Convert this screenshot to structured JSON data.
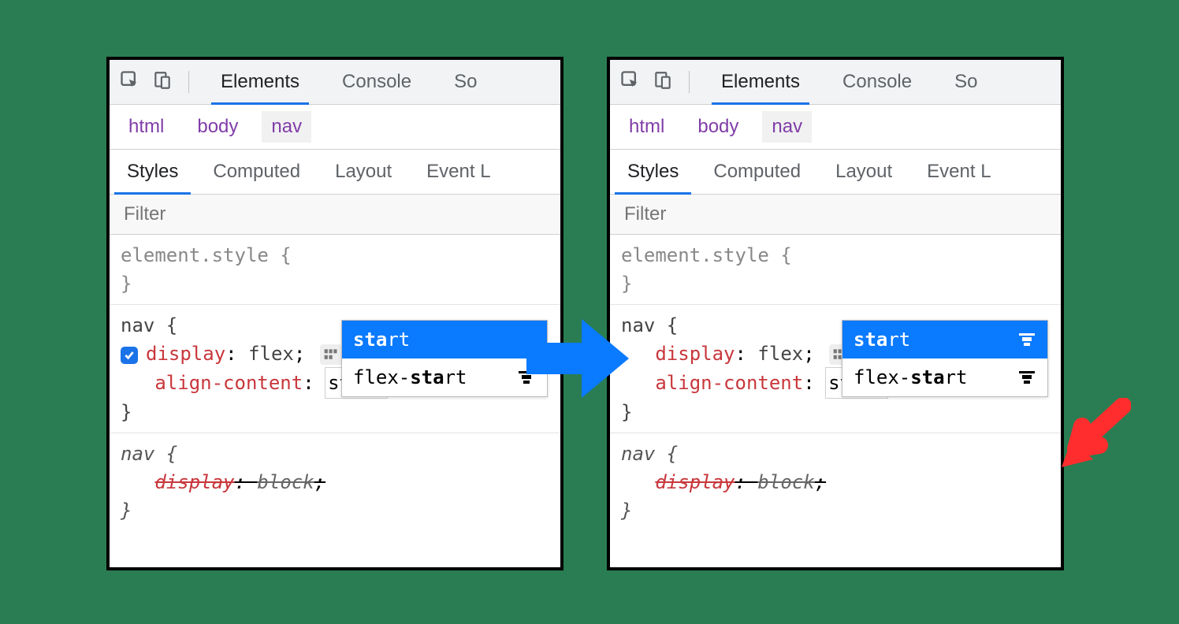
{
  "toolbar": {
    "tabs": [
      "Elements",
      "Console",
      "So"
    ]
  },
  "breadcrumbs": [
    "html",
    "body",
    "nav"
  ],
  "subtabs": [
    "Styles",
    "Computed",
    "Layout",
    "Event L"
  ],
  "filter_placeholder": "Filter",
  "rules": {
    "element_style_selector": "element.style",
    "nav_selector": "nav",
    "display_prop": "display",
    "display_val": "flex",
    "align_prop": "align-content",
    "align_val": "start",
    "semicolon": ";",
    "overridden_selector": "nav",
    "overridden_prop": "display",
    "overridden_val": "block"
  },
  "popup": {
    "items": [
      {
        "label_bold": "sta",
        "label_rest": "rt",
        "has_icon": false
      },
      {
        "label_pre": "flex-",
        "label_bold": "sta",
        "label_rest": "rt",
        "has_icon": true
      }
    ],
    "items_right": [
      {
        "label_bold": "sta",
        "label_rest": "rt",
        "has_icon": true
      },
      {
        "label_pre": "flex-",
        "label_bold": "sta",
        "label_rest": "rt",
        "has_icon": true
      }
    ]
  }
}
